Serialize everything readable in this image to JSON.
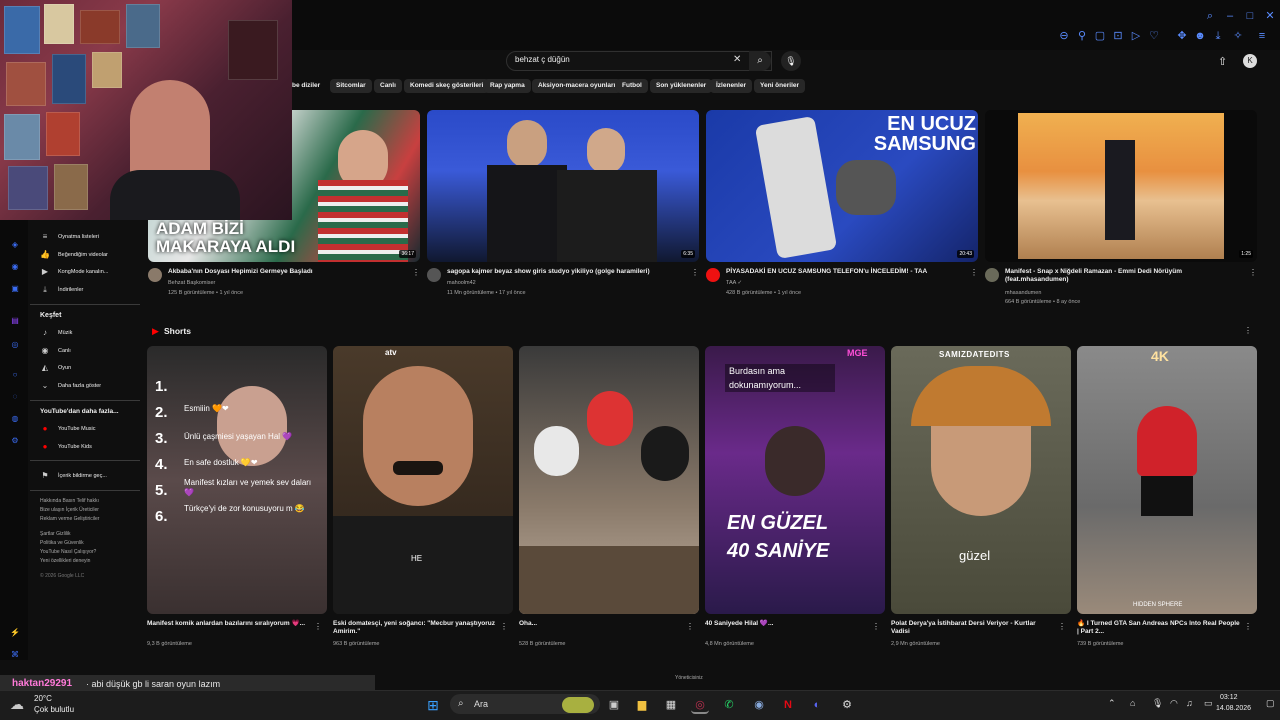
{
  "search": {
    "query": "behzat ç düğün",
    "clear_icon": "close-icon",
    "search_icon": "search-icon",
    "mic_icon": "mic-icon"
  },
  "header": {
    "avatar_letter": "K"
  },
  "chips": [
    "be diziler",
    "Sitcomlar",
    "Canlı",
    "Komedi skeç gösterileri",
    "Rap yapma",
    "Aksiyon-macera oyunları",
    "Futbol",
    "Son yüklenenler",
    "İzlenenler",
    "Yeni öneriler"
  ],
  "sidebar": {
    "items_top": [
      {
        "label": "Oynatma listeleri",
        "icon": "playlist-icon"
      },
      {
        "label": "Beğendiğim videolar",
        "icon": "like-icon"
      },
      {
        "label": "KongMode kanalın...",
        "icon": "video-icon"
      },
      {
        "label": "İndirilenler",
        "icon": "download-icon"
      }
    ],
    "explore_heading": "Keşfet",
    "explore_items": [
      {
        "label": "Müzik",
        "icon": "music-icon"
      },
      {
        "label": "Canlı",
        "icon": "live-icon"
      },
      {
        "label": "Oyun",
        "icon": "gaming-icon"
      },
      {
        "label": "Daha fazla göster",
        "icon": "chevron-down-icon"
      }
    ],
    "more_heading": "YouTube'dan daha fazla...",
    "more_items": [
      {
        "label": "YouTube Music",
        "icon": "yt-music-icon"
      },
      {
        "label": "YouTube Kids",
        "icon": "yt-kids-icon"
      }
    ],
    "report_item": {
      "label": "İçerik bildirme geç...",
      "icon": "flag-icon"
    },
    "footer_lines": [
      "Hakkında  Basın  Telif hakkı",
      "Bize ulaşın  İçerik Üreticiler",
      "Reklam verme  Geliştiriciler",
      "",
      "Şartlar  Gizlilik",
      "Politika ve Güvenlik",
      "YouTube Nasıl Çalışıyor?",
      "Yeni özellikleri deneyin",
      "",
      "© 2026 Google LLC"
    ]
  },
  "videos": [
    {
      "title": "Akbaba'nın Dosyası Hepimizi Germeye Başladı",
      "channel": "Behzat Başkomiser",
      "meta": "125 B görüntüleme • 1 yıl önce",
      "duration": "36:17",
      "overlay": "ADAM BİZİ MAKARAYA ALDI"
    },
    {
      "title": "sagopa kajmer beyaz show giris studyo yikiliyo (golge haramileri)",
      "channel": "mahoolm42",
      "meta": "11 Mn görüntüleme • 17 yıl önce",
      "duration": "6:35",
      "overlay": ""
    },
    {
      "title": "PİYASADAKİ EN UCUZ SAMSUNG TELEFON'u İNCELEDİM! - TAA",
      "channel": "TAA ✓",
      "meta": "428 B görüntüleme • 1 yıl önce",
      "duration": "20:43",
      "overlay": "EN UCUZ SAMSUNG"
    },
    {
      "title": "Manifest - Snap x Niğdeli Ramazan - Emmi Dedi Nörüyüm (feat.mhasandumen)",
      "channel": "mhasandumen",
      "meta": "664 B görüntüleme • 8 ay önce",
      "duration": "1:25",
      "overlay": ""
    }
  ],
  "shorts_heading": "Shorts",
  "shorts": [
    {
      "title": "Manifest komik anlardan bazılarını sıralıyorum 💗...",
      "meta": "9,3 B görüntüleme",
      "list": [
        "1.",
        "2.",
        "3.",
        "4.",
        "5.",
        "6."
      ],
      "captions": [
        "Esmiiin 🧡❤",
        "Ünlü çaşmiesi yaşayan Hal 💜",
        "En safe dostluk 💛❤",
        "Manifest kızları ve yemek sev daları 💜",
        "Türkçe'yi de zor konusuyoru m 😂"
      ]
    },
    {
      "title": "Eski domatesçi, yeni soğancı: \"Mecbur yanaştıyoruz Amirim.\"",
      "meta": "963 B görüntüleme",
      "overlay": "HE",
      "brand": "atv"
    },
    {
      "title": "Oha...",
      "meta": "528 B görüntüleme"
    },
    {
      "title": "40 Saniyede Hilal 💜...",
      "meta": "4,8 Mn görüntüleme",
      "top_caption": "Burdasın ama dokunamıyorum...",
      "big_caption_1": "EN GÜZEL",
      "big_caption_2": "40 SANİYE",
      "tag": "MGE"
    },
    {
      "title": "Polat Derya'ya İstihbarat Dersi Veriyor - Kurtlar Vadisi",
      "meta": "2,9 Mn görüntüleme",
      "top_caption": "SAMIZDATEDITS",
      "overlay": "güzel"
    },
    {
      "title": "🔥 I Turned GTA San Andreas NPCs Into Real People | Part 2...",
      "meta": "739 B görüntüleme",
      "badge": "4K",
      "overlay": "HIDDEN SPHERE"
    }
  ],
  "chat": {
    "user": "haktan29291",
    "message": "· abi düşük gb li saran oyun lazım"
  },
  "taskbar": {
    "weather_temp": "20°C",
    "weather_desc": "Çok bulutlu",
    "search_label": "Ara",
    "time": "03:12",
    "date": "14.08.2026",
    "tooltip": "Yöneticisiniz"
  },
  "colors": {
    "accent": "#ff0000",
    "rail": "#3b6cf2",
    "chat_user": "#ff7ad9"
  }
}
